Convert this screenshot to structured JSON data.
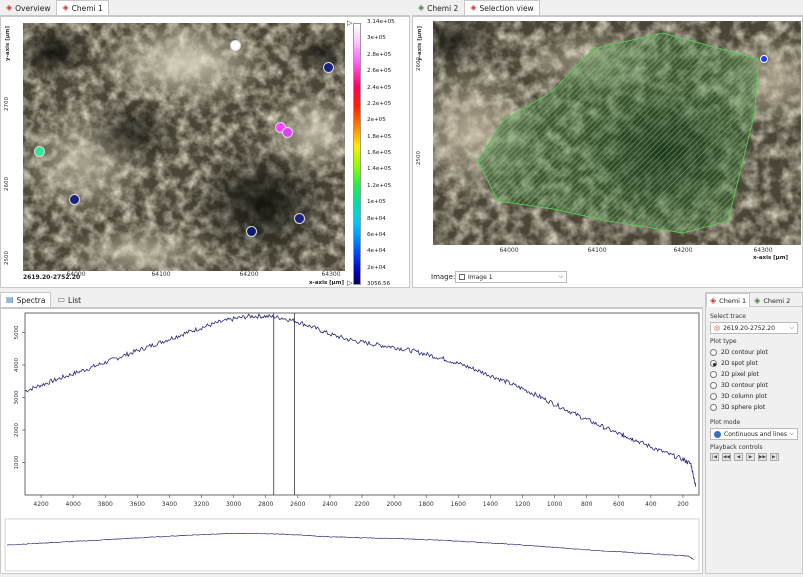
{
  "top_tabs_left": [
    {
      "label": "Overview",
      "icon": "overview-icon",
      "active": false
    },
    {
      "label": "Chemi 1",
      "icon": "chemi-icon",
      "active": true
    }
  ],
  "top_tabs_right": [
    {
      "label": "Chemi 2",
      "icon": "chemi2-icon",
      "active": false
    },
    {
      "label": "Selection view",
      "icon": "selection-icon",
      "active": true
    }
  ],
  "left_view": {
    "y_axis_label": "y-axis [μm]",
    "y_ticks": [
      "2500",
      "2600",
      "2700"
    ],
    "x_ticks": [
      "64000",
      "64100",
      "64200",
      "64300"
    ],
    "x_axis_label": "x-axis [μm]",
    "range_label": "2619.20-2752.20",
    "spots": [
      {
        "x": 0.66,
        "y": 0.09,
        "color": "#ffffff"
      },
      {
        "x": 0.95,
        "y": 0.18,
        "color": "#1a237e"
      },
      {
        "x": 0.8,
        "y": 0.42,
        "color": "#ff44ff"
      },
      {
        "x": 0.82,
        "y": 0.44,
        "color": "#e040fb"
      },
      {
        "x": 0.05,
        "y": 0.52,
        "color": "#2ee89a"
      },
      {
        "x": 0.16,
        "y": 0.71,
        "color": "#1a237e"
      },
      {
        "x": 0.86,
        "y": 0.79,
        "color": "#1a237e"
      },
      {
        "x": 0.71,
        "y": 0.84,
        "color": "#0d1b6e"
      }
    ]
  },
  "colorbar": {
    "labels": [
      "3.14e+05",
      "3e+05",
      "2.8e+05",
      "2.6e+05",
      "2.4e+05",
      "2.2e+05",
      "2e+05",
      "1.8e+05",
      "1.6e+05",
      "1.4e+05",
      "1.2e+05",
      "1e+05",
      "8e+04",
      "6e+04",
      "4e+04",
      "2e+04",
      "3056.56"
    ]
  },
  "right_view": {
    "y_axis_label": "y-axis [μm]",
    "y_ticks": [
      "2500",
      "2600"
    ],
    "x_ticks": [
      "64000",
      "64100",
      "64200",
      "64300"
    ],
    "x_axis_label": "x-axis [μm]",
    "image_label": "Image:",
    "image_value": "Image 1"
  },
  "bottom_tabs": [
    {
      "label": "Spectra",
      "icon": "spectra-icon",
      "active": true
    },
    {
      "label": "List",
      "icon": "list-icon",
      "active": false
    }
  ],
  "chart_data": {
    "type": "line",
    "title": "",
    "xlabel": "",
    "ylabel": "",
    "x_ticks": [
      4200,
      4000,
      3800,
      3600,
      3400,
      3200,
      3000,
      2800,
      2600,
      2400,
      2200,
      2000,
      1800,
      1600,
      1400,
      1200,
      1000,
      800,
      600,
      400,
      200
    ],
    "y_ticks": [
      1000,
      2000,
      3000,
      4000,
      5000
    ],
    "xlim": [
      4300,
      100
    ],
    "ylim": [
      0,
      5600
    ],
    "cursors": [
      2750,
      2620
    ],
    "series": [
      {
        "x": [
          4300,
          4200,
          4100,
          4000,
          3900,
          3800,
          3700,
          3600,
          3500,
          3400,
          3300,
          3200,
          3100,
          3000,
          2900,
          2800,
          2700,
          2600,
          2500,
          2400,
          2300,
          2200,
          2100,
          2000,
          1900,
          1800,
          1700,
          1600,
          1500,
          1400,
          1300,
          1200,
          1100,
          1000,
          900,
          800,
          700,
          600,
          550,
          500,
          400,
          300,
          200,
          150,
          120
        ],
        "y": [
          3200,
          3380,
          3560,
          3730,
          3900,
          4080,
          4260,
          4440,
          4620,
          4800,
          4980,
          5150,
          5300,
          5420,
          5500,
          5500,
          5450,
          5330,
          5150,
          4950,
          4800,
          4700,
          4620,
          4550,
          4450,
          4330,
          4200,
          4050,
          3870,
          3680,
          3480,
          3270,
          3040,
          2800,
          2560,
          2320,
          2100,
          1880,
          1800,
          1700,
          1480,
          1280,
          1100,
          950,
          250
        ]
      }
    ]
  },
  "side_panel": {
    "tabs": [
      {
        "label": "Chemi 1",
        "icon": "chemi-icon",
        "active": true
      },
      {
        "label": "Chemi 2",
        "icon": "chemi2-icon",
        "active": false
      }
    ],
    "select_trace_label": "Select trace",
    "select_trace_value": "2619.20-2752.20",
    "plot_type_label": "Plot type",
    "plot_types": [
      {
        "label": "2D contour plot",
        "selected": false
      },
      {
        "label": "2D spot plot",
        "selected": true
      },
      {
        "label": "2D pixel plot",
        "selected": false
      },
      {
        "label": "3D contour plot",
        "selected": false
      },
      {
        "label": "3D column plot",
        "selected": false
      },
      {
        "label": "3D sphere plot",
        "selected": false
      }
    ],
    "plot_mode_label": "Plot mode",
    "plot_mode_value": "Continuous and lines",
    "playback_label": "Playback controls",
    "playback_buttons": [
      "|◀",
      "◀◀",
      "◀",
      "▶",
      "▶▶",
      "▶|"
    ]
  }
}
